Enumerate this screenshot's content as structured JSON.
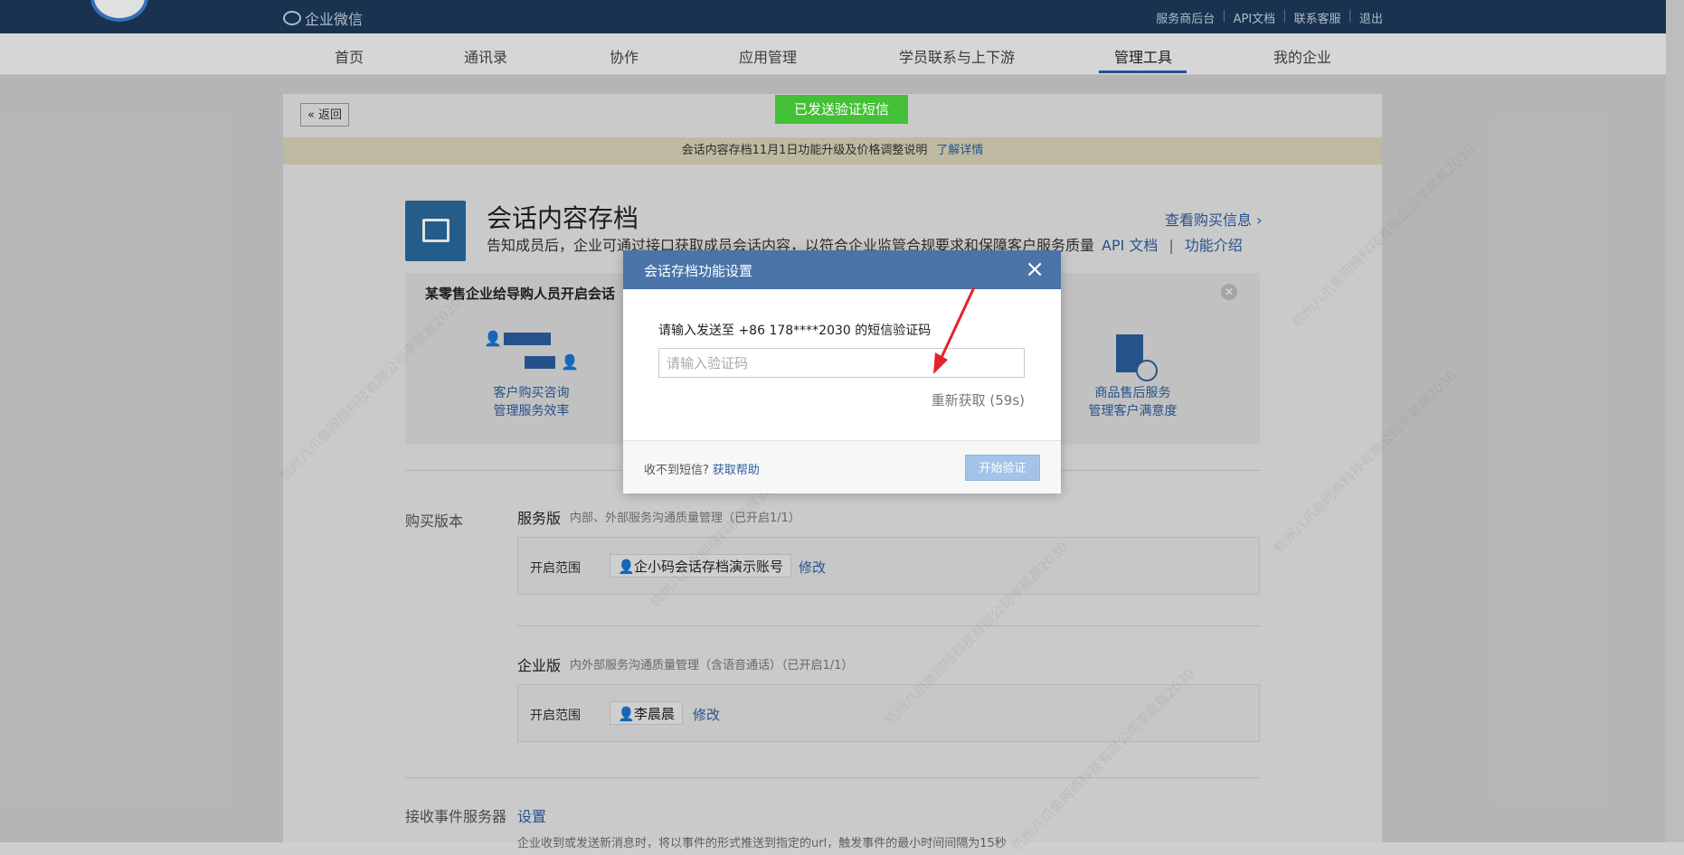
{
  "header": {
    "brand": "企业微信",
    "links": [
      "服务商后台",
      "API文档",
      "联系客服",
      "退出"
    ]
  },
  "nav": {
    "items": [
      "首页",
      "通讯录",
      "协作",
      "应用管理",
      "学员联系与上下游",
      "管理工具",
      "我的企业"
    ],
    "active": "管理工具"
  },
  "page": {
    "back_label": "返回",
    "notice_text": "会话内容存档11月1日功能升级及价格调整说明",
    "notice_link": "了解详情",
    "app_title": "会话内容存档",
    "app_desc": "告知成员后，企业可通过接口获取成员会话内容，以符合企业监管合规要求和保障客户服务质量",
    "api_doc": "API 文档",
    "intro": "功能介绍",
    "buy_info": "查看购买信息",
    "case_title": "某零售企业给导购人员开启会话",
    "features": [
      {
        "line1": "客户购买咨询",
        "line2": "管理服务效率"
      },
      {
        "line1": "商品售后服务",
        "line2": "管理客户满意度"
      }
    ],
    "purchase_label": "购买版本",
    "versions": [
      {
        "name": "服务版",
        "desc": "内部、外部服务沟通质量管理（已开启1/1）",
        "scope_label": "开启范围",
        "member": "企小码会话存档演示账号",
        "edit": "修改"
      },
      {
        "name": "企业版",
        "desc": "内外部服务沟通质量管理（含语音通话）（已开启1/1）",
        "scope_label": "开启范围",
        "member": "李晨晨",
        "edit": "修改"
      }
    ],
    "event_label": "接收事件服务器",
    "event_link": "设置",
    "event_desc": "企业收到或发送新消息时，将以事件的形式推送到指定的url，触发事件的最小时间间隔为15秒"
  },
  "toast": "已发送验证短信",
  "modal": {
    "title": "会话存档功能设置",
    "prompt": "请输入发送至 +86 178****2030 的短信验证码",
    "placeholder": "请输入验证码",
    "resend": "重新获取 (59s)",
    "no_sms": "收不到短信?",
    "help": "获取帮助",
    "verify": "开始验证"
  },
  "watermark": "杭州八爪鱼网络科技有限公司李晨晨2030",
  "colors": {
    "header_bg": "#1c3a5c",
    "modal_header": "#4a73a8",
    "toast": "#43c036",
    "link": "#2c5ea0",
    "arrow": "#e3232a"
  }
}
